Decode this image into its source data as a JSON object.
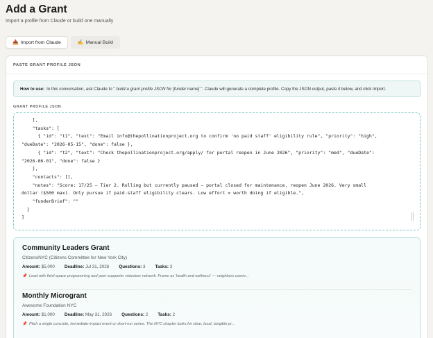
{
  "header": {
    "title": "Add a Grant",
    "subtitle": "Import a profile from Claude or build one manually"
  },
  "tabs": [
    {
      "label": "Import from Claude",
      "icon": "📥",
      "active": true
    },
    {
      "label": "Manual Build",
      "icon": "✍️",
      "active": false
    }
  ],
  "card": {
    "title": "PASTE GRANT PROFILE JSON",
    "howto": {
      "lead": "How to use:",
      "text_before": "In this conversation, ask Claude to \"",
      "prompt": "build a grant profile JSON for [funder name]",
      "text_after": "\". Claude will generate a complete profile. Copy the JSON output, paste it below, and click Import."
    },
    "field_label": "GRANT PROFILE JSON",
    "json_text": "    ],\n    \"tasks\": [\n      { \"id\": \"t1\", \"text\": \"Email info@thepollinationproject.org to confirm 'no paid staff' eligibility rule\", \"priority\": \"high\",\n\"dueDate\": \"2026-05-15\", \"done\": false },\n      { \"id\": \"t2\", \"text\": \"Check thepollinationproject.org/apply/ for portal reopen in June 2026\", \"priority\": \"med\", \"dueDate\":\n\"2026-06-01\", \"done\": false }\n    ],\n    \"contacts\": [],\n    \"notes\": \"Score: 17/25 — Tier 2. Rolling but currently paused — portal closed for maintenance, reopen June 2026. Very small\ndollar ($500 max). Only pursue if paid-staff eligibility clears. Low effort = worth doing if eligible.\",\n    \"funderBrief\": \"\"\n  }\n]"
  },
  "grants": [
    {
      "name": "Community Leaders Grant",
      "org": "CitizensNYC (Citizens Committee for New York City)",
      "amount_label": "Amount:",
      "amount": "$5,000",
      "deadline_label": "Deadline:",
      "deadline": "Jul 31, 2026",
      "questions_label": "Questions:",
      "questions": "3",
      "tasks_label": "Tasks:",
      "tasks": "3",
      "note": "Lead with third-space programming and peer-supporter volunteer network. Frame as 'health and wellness' — neighbors comin..."
    },
    {
      "name": "Monthly Microgrant",
      "org": "Awesome Foundation NYC",
      "amount_label": "Amount:",
      "amount": "$1,000",
      "deadline_label": "Deadline:",
      "deadline": "May 31, 2026",
      "questions_label": "Questions:",
      "questions": "2",
      "tasks_label": "Tasks:",
      "tasks": "2",
      "note": "Pitch a single concrete, immediate-impact event or short-run series. The NYC chapter looks for clear, local, tangible pr..."
    }
  ],
  "colors": {
    "accent": "#74c2bd",
    "info_bg": "#eef7f6",
    "pin": "#d2453a"
  }
}
